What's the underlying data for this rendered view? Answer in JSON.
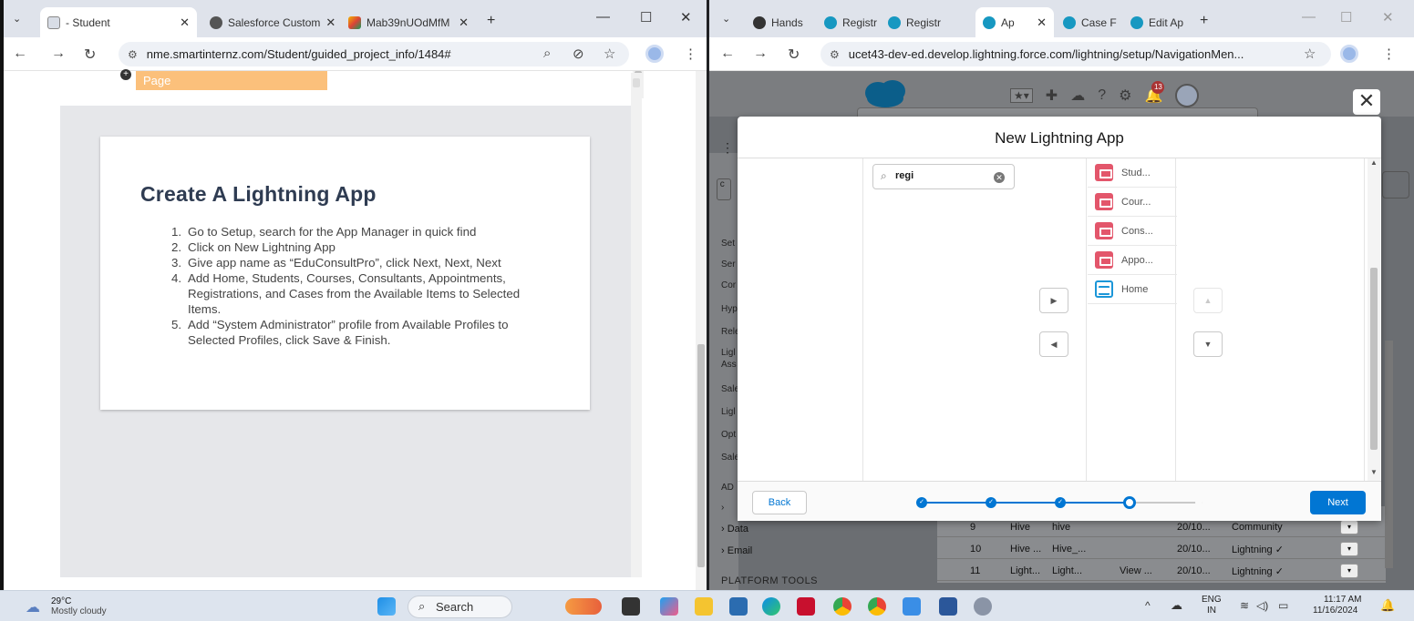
{
  "left_browser": {
    "tabs": [
      {
        "label": "- Student",
        "active": true
      },
      {
        "label": "Salesforce Custom",
        "active": false
      },
      {
        "label": "Mab39nUOdMfM",
        "active": false
      }
    ],
    "url": "nme.smartinternz.com/Student/guided_project_info/1484#",
    "content": {
      "orange_label": "Page",
      "card_title": "Create A Lightning App",
      "steps": [
        {
          "num": "1.",
          "text": "Go to Setup, search for the App Manager in quick find"
        },
        {
          "num": "2.",
          "text": "Click on New Lightning App"
        },
        {
          "num": "3.",
          "text": "Give app name as “EduConsultPro”, click Next, Next, Next"
        },
        {
          "num": "4.",
          "text": "Add Home, Students, Courses, Consultants, Appointments, Registrations, and Cases from the Available Items to Selected Items."
        },
        {
          "num": "5.",
          "text": "Add “System Administrator” profile from Available Profiles to Selected Profiles, click Save & Finish."
        }
      ]
    }
  },
  "right_browser": {
    "tabs": [
      {
        "label": "Hands",
        "active": false
      },
      {
        "label": "Registr",
        "active": false
      },
      {
        "label": "Registr",
        "active": false
      },
      {
        "label": "Ap",
        "active": true
      },
      {
        "label": "Case F",
        "active": false
      },
      {
        "label": "Edit Ap",
        "active": false
      }
    ],
    "url": "ucet43-dev-ed.develop.lightning.force.com/lightning/setup/NavigationMen...",
    "header": {
      "notification_count": "13"
    },
    "sidebar_items": [
      "Set",
      "Ser",
      "Cor",
      "Hyp",
      "Rele",
      "Ligl",
      "Ass",
      "Sale",
      "Ligl",
      "Opt",
      "Sale"
    ],
    "sidebar_bottom": {
      "section": "AD",
      "data": "Data",
      "email": "Email",
      "platform_tools": "PLATFORM TOOLS"
    },
    "table_rows": [
      {
        "num": "9",
        "c1": "Hive",
        "c2": "hive",
        "c3": "",
        "date": "20/10...",
        "type": "Community"
      },
      {
        "num": "10",
        "c1": "Hive ...",
        "c2": "Hive_...",
        "c3": "",
        "date": "20/10...",
        "type": "Lightning ✓"
      },
      {
        "num": "11",
        "c1": "Light...",
        "c2": "Light...",
        "c3": "View ...",
        "date": "20/10...",
        "type": "Lightning ✓"
      }
    ],
    "modal": {
      "title": "New Lightning App",
      "search_value": "regi",
      "selected_items": [
        {
          "label": "Stud...",
          "icon": "object-icon"
        },
        {
          "label": "Cour...",
          "icon": "object-icon"
        },
        {
          "label": "Cons...",
          "icon": "object-icon"
        },
        {
          "label": "Appo...",
          "icon": "object-icon"
        },
        {
          "label": "Home",
          "icon": "home-icon"
        }
      ],
      "back_label": "Back",
      "next_label": "Next",
      "progress_steps": 5,
      "current_step": 4
    }
  },
  "taskbar": {
    "temperature": "29°C",
    "weather": "Mostly cloudy",
    "search_label": "Search",
    "lang_top": "ENG",
    "lang_bottom": "IN",
    "time": "11:17 AM",
    "date": "11/16/2024"
  }
}
